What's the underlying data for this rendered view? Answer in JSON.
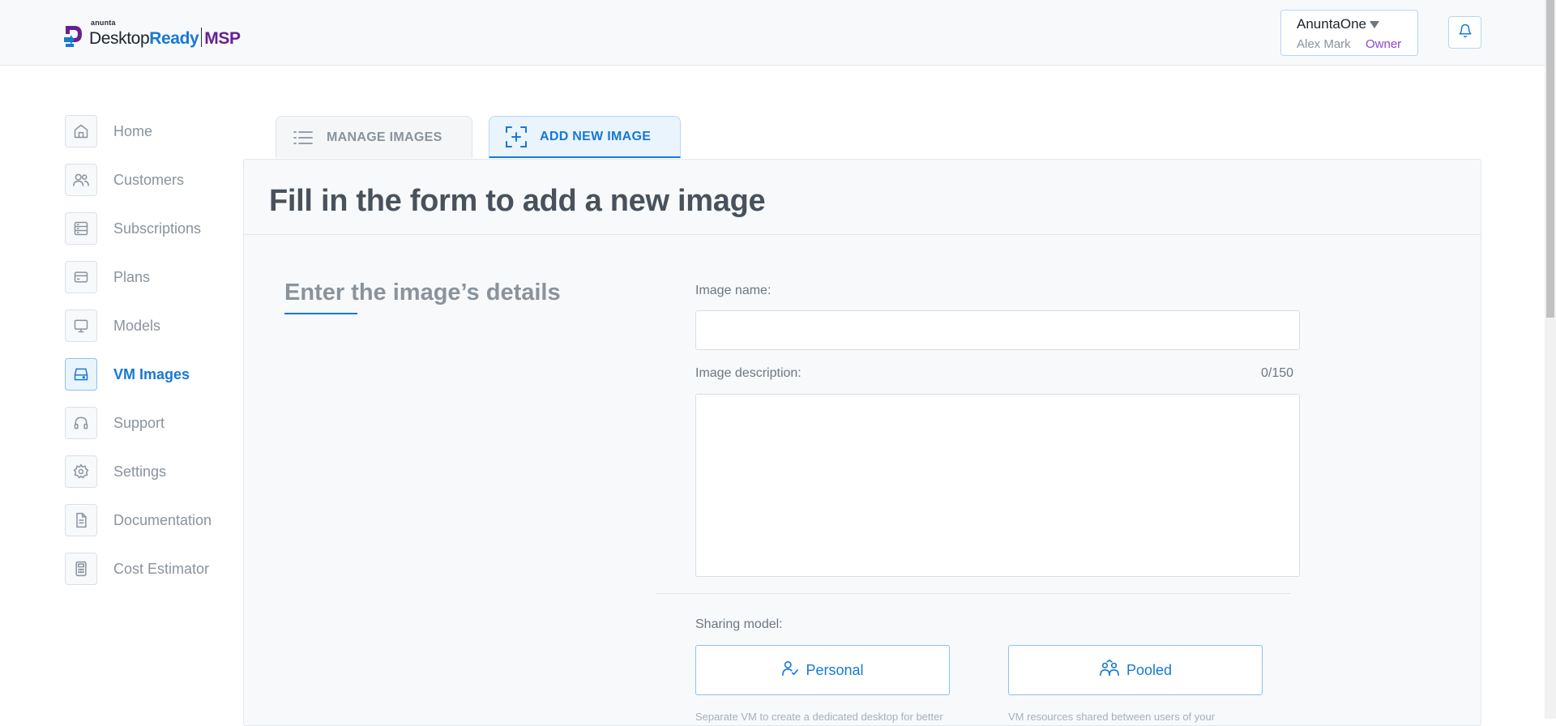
{
  "header": {
    "logo": {
      "small": "anunta",
      "desktop": "Desktop",
      "ready": "Ready",
      "msp": "MSP"
    },
    "account": {
      "name": "AnuntaOne",
      "user": "Alex Mark",
      "role": "Owner"
    },
    "icons": [
      "caret-down-icon",
      "bell-icon"
    ]
  },
  "sidebar": {
    "items": [
      {
        "label": "Home",
        "icon": "home-icon",
        "active": false
      },
      {
        "label": "Customers",
        "icon": "users-icon",
        "active": false
      },
      {
        "label": "Subscriptions",
        "icon": "server-icon",
        "active": false
      },
      {
        "label": "Plans",
        "icon": "card-icon",
        "active": false
      },
      {
        "label": "Models",
        "icon": "monitor-icon",
        "active": false
      },
      {
        "label": "VM Images",
        "icon": "drive-icon",
        "active": true
      },
      {
        "label": "Support",
        "icon": "headset-icon",
        "active": false
      },
      {
        "label": "Settings",
        "icon": "gear-icon",
        "active": false
      },
      {
        "label": "Documentation",
        "icon": "document-icon",
        "active": false
      },
      {
        "label": "Cost Estimator",
        "icon": "calculator-icon",
        "active": false
      }
    ]
  },
  "tabs": {
    "manage": "MANAGE IMAGES",
    "add": "ADD NEW IMAGE",
    "active": "add"
  },
  "form": {
    "title": "Fill in the form to add a new image",
    "section_title": "Enter the image’s details",
    "image_name_label": "Image name:",
    "image_name_value": "",
    "image_description_label": "Image description:",
    "image_description_value": "",
    "description_counter": "0/150",
    "sharing_model_label": "Sharing model:",
    "sharing_options": {
      "personal": "Personal",
      "pooled": "Pooled"
    },
    "personal_desc": "Separate VM to create a dedicated desktop for better",
    "pooled_desc": "VM resources shared between users of your"
  },
  "colors": {
    "accent": "#1778d6",
    "brand_purple": "#6a1f8f",
    "role": "#8e44c8",
    "muted_text": "#8a939c",
    "panel_bg": "#f7f9fb"
  }
}
